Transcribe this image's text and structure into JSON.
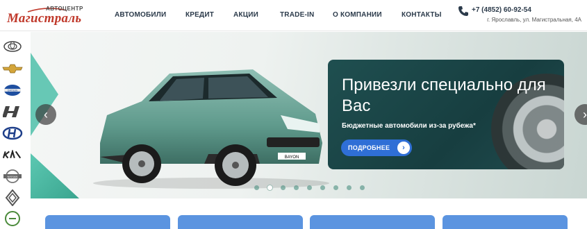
{
  "header": {
    "logo_top": "АВТОЦЕНТР",
    "logo_main": "Магистраль",
    "nav": [
      "АВТОМОБИЛИ",
      "КРЕДИТ",
      "АКЦИИ",
      "TRADE-IN",
      "О КОМПАНИИ",
      "КОНТАКТЫ"
    ],
    "phone": "+7 (4852) 60-92-54",
    "address": "г. Ярославль, ул. Магистральная, 4А"
  },
  "brands": [
    "toyota-icon",
    "chevrolet-icon",
    "datsun-icon",
    "haval-icon",
    "hyundai-icon",
    "kia-icon",
    "nissan-icon",
    "renault-icon",
    "skoda-icon"
  ],
  "slide": {
    "title": "Привезли специально для Вас",
    "subtitle": "Бюджетные автомобили из-за рубежа*",
    "button_label": "ПОДРОБНЕЕ",
    "car_plate": "BAYON",
    "active_index": 1,
    "total": 9
  },
  "colors": {
    "brand_red": "#c0392b",
    "accent_blue": "#2f6fd6",
    "card_dark": "#1f4f50",
    "teal": "#4dc0a9"
  }
}
